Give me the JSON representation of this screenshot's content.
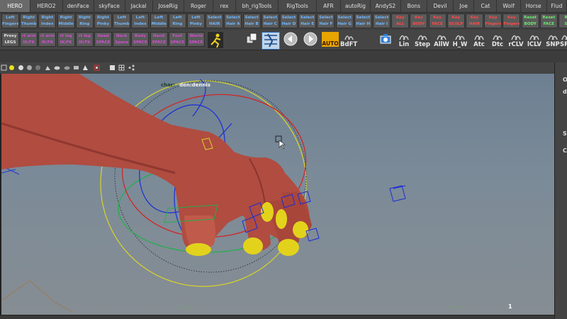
{
  "shelf_tabs": [
    {
      "label": "HERO",
      "active": true,
      "w": 44
    },
    {
      "label": "HERO2",
      "w": 47
    },
    {
      "label": "denFace",
      "w": 45
    },
    {
      "label": "skyFace",
      "w": 45
    },
    {
      "label": "Jackal",
      "w": 40
    },
    {
      "label": "JoseRig",
      "w": 45
    },
    {
      "label": "Roger",
      "w": 43
    },
    {
      "label": "rex",
      "w": 32
    },
    {
      "label": "bh_rigTools",
      "w": 62
    },
    {
      "label": "RigTools",
      "w": 55
    },
    {
      "label": "AFR",
      "w": 35
    },
    {
      "label": "autoRig",
      "w": 43
    },
    {
      "label": "AndyS2",
      "w": 44
    },
    {
      "label": "Bons",
      "w": 38
    },
    {
      "label": "Devil",
      "w": 38
    },
    {
      "label": "Joe",
      "w": 30
    },
    {
      "label": "Cat",
      "w": 33
    },
    {
      "label": "Wolf",
      "w": 34
    },
    {
      "label": "Horse",
      "w": 38
    },
    {
      "label": "Flud",
      "w": 29
    }
  ],
  "row1": [
    {
      "l1": "Left",
      "l2": "Fingers",
      "c": "blue"
    },
    {
      "l1": "Right",
      "l2": "Thumb",
      "c": "blue"
    },
    {
      "l1": "Right",
      "l2": "Index",
      "c": "blue"
    },
    {
      "l1": "Right",
      "l2": "Middle",
      "c": "blue"
    },
    {
      "l1": "Right",
      "l2": "Ring",
      "c": "blue"
    },
    {
      "l1": "Right",
      "l2": "Pinky",
      "c": "blue"
    },
    {
      "l1": "Left",
      "l2": "Thumb",
      "c": "blue"
    },
    {
      "l1": "Left",
      "l2": "Index",
      "c": "blue"
    },
    {
      "l1": "Left",
      "l2": "Middle",
      "c": "blue"
    },
    {
      "l1": "Left",
      "l2": "Ring",
      "c": "blue"
    },
    {
      "l1": "Left",
      "l2": "Pinky",
      "c": "blue"
    },
    {
      "l1": "Select",
      "l2": "HAIR",
      "c": "blue"
    },
    {
      "l1": "Select",
      "l2": "Hair A",
      "c": "blue"
    },
    {
      "l1": "Select",
      "l2": "Hair B",
      "c": "blue"
    },
    {
      "l1": "Select",
      "l2": "Hair C",
      "c": "blue"
    },
    {
      "l1": "Select",
      "l2": "Hair D",
      "c": "blue"
    },
    {
      "l1": "Select",
      "l2": "Hair E",
      "c": "blue"
    },
    {
      "l1": "Select",
      "l2": "Hair F",
      "c": "blue"
    },
    {
      "l1": "Select",
      "l2": "Hair G",
      "c": "blue"
    },
    {
      "l1": "Select",
      "l2": "Hair H",
      "c": "blue"
    },
    {
      "l1": "Select",
      "l2": "Hair I",
      "c": "blue"
    },
    {
      "l1": "Key",
      "l2": "ALL",
      "c": "red"
    },
    {
      "l1": "Key",
      "l2": "BODY",
      "c": "red"
    },
    {
      "l1": "Key",
      "l2": "FACE",
      "c": "red"
    },
    {
      "l1": "Key",
      "l2": "SCULP",
      "c": "red"
    },
    {
      "l1": "Key",
      "l2": "HAIR",
      "c": "red"
    },
    {
      "l1": "Key",
      "l2": "Fingers",
      "c": "red"
    },
    {
      "l1": "Key",
      "l2": "Fingers",
      "c": "red"
    },
    {
      "l1": "Reset",
      "l2": "BODY",
      "c": "green"
    },
    {
      "l1": "Reset",
      "l2": "FACE",
      "c": "green"
    },
    {
      "l1": "Re",
      "l2": "SC",
      "c": "green"
    }
  ],
  "row2_left": [
    {
      "l1": "Proxy",
      "l2": "LEGS",
      "c": "white"
    },
    {
      "l1": "rt arm",
      "l2": "IK/FK",
      "c": "mag"
    },
    {
      "l1": "rt arm",
      "l2": "IK/FK",
      "c": "mag"
    },
    {
      "l1": "rt leg",
      "l2": "IK/FK",
      "c": "mag"
    },
    {
      "l1": "rt leg",
      "l2": "IK/FK",
      "c": "mag"
    },
    {
      "l1": "Head",
      "l2": "SPACE",
      "c": "mag"
    },
    {
      "l1": "Neck",
      "l2": "Space",
      "c": "mag"
    },
    {
      "l1": "Body",
      "l2": "SPACE",
      "c": "mag"
    },
    {
      "l1": "Hand",
      "l2": "SPACE",
      "c": "mag"
    },
    {
      "l1": "Foot",
      "l2": "SPACE",
      "c": "mag"
    },
    {
      "l1": "World",
      "l2": "SPACE",
      "c": "mag"
    }
  ],
  "row2_tools": {
    "auto": "AUTO",
    "bdft": "BdFT",
    "lin": "Lin",
    "step": "Step",
    "allw": "AllW",
    "hw": "H_W",
    "atc": "Atc",
    "dtc": "Dtc",
    "rclv": "rCLV",
    "lclv": "lCLV",
    "snp": "SNP",
    "sr": "SR"
  },
  "viewport": {
    "char_label": "char:",
    "char_name": "den:dennis",
    "frame": "1"
  },
  "right_panel": {
    "labels": [
      "O",
      "d",
      "S",
      "C"
    ]
  },
  "colors": {
    "skin": "#b04c40",
    "skin_dark": "#7c2c24",
    "nail": "#e3d21c",
    "ctrl_blue": "#1a2cd8",
    "ctrl_green": "#1fb04a",
    "ctrl_red": "#d62020",
    "ctrl_yellow": "#d8d428"
  }
}
